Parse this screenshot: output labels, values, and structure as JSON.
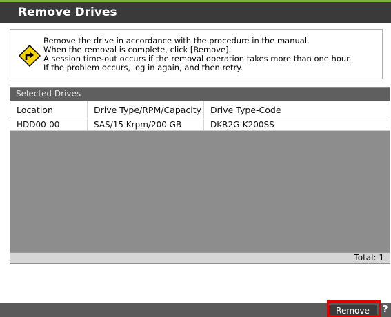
{
  "dialog": {
    "title": "Remove Drives"
  },
  "info": {
    "icon": "warning-diamond-icon",
    "lines": [
      "Remove the drive in accordance with the procedure in the manual.",
      "When the removal is complete, click [Remove].",
      "A session time-out occurs if the removal operation takes more than one hour.",
      "If the problem occurs, log in again, and then retry."
    ]
  },
  "table": {
    "title": "Selected Drives",
    "columns": [
      "Location",
      "Drive Type/RPM/Capacity",
      "Drive Type-Code"
    ],
    "rows": [
      [
        "HDD00-00",
        "SAS/15 Krpm/200 GB",
        "DKR2G-K200SS"
      ]
    ],
    "total": "Total: 1"
  },
  "footer": {
    "remove_label": "Remove",
    "help_label": "?"
  },
  "colors": {
    "title_accent": "#7ab342",
    "highlight": "#e00000"
  }
}
